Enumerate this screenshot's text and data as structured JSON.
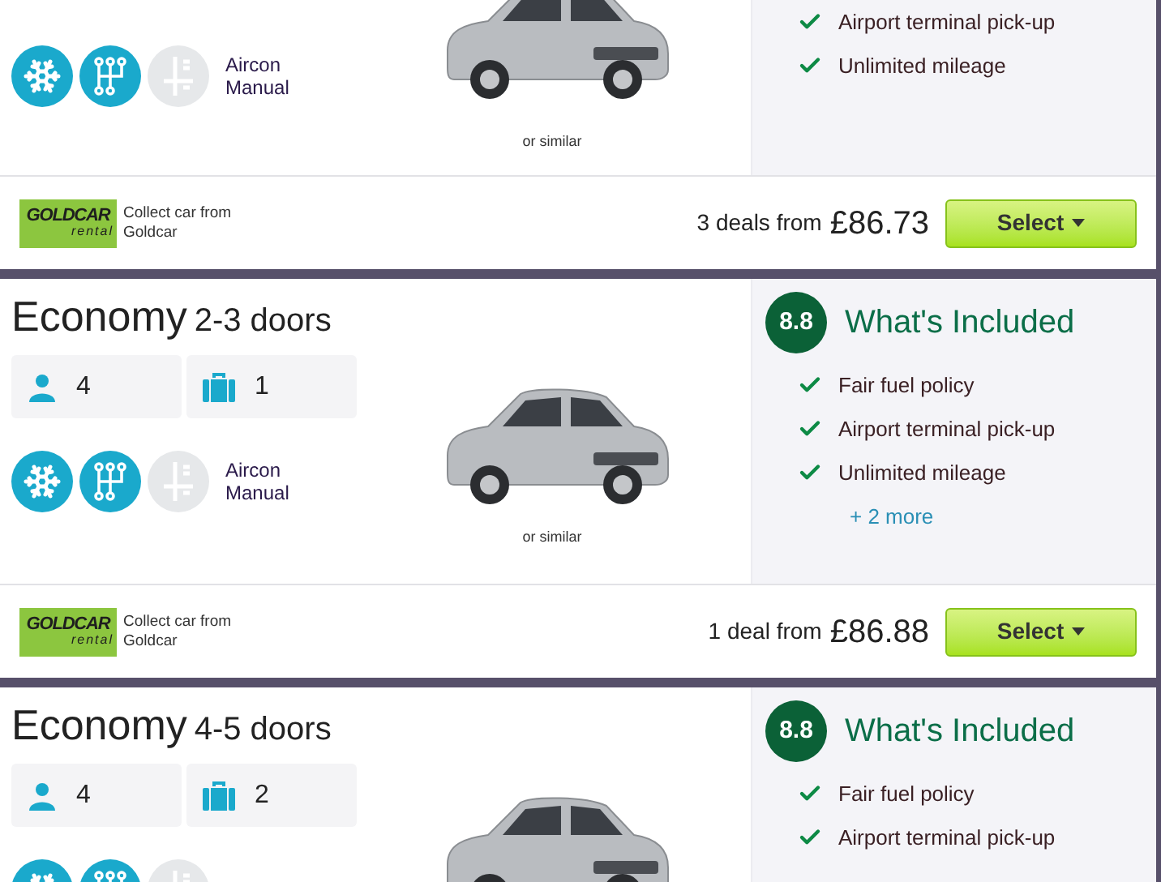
{
  "cards": [
    {
      "features": [
        {
          "kind": "snowflake",
          "on": true
        },
        {
          "kind": "gearshift",
          "on": true
        },
        {
          "kind": "lever",
          "on": false
        }
      ],
      "feature_labels": [
        "Aircon",
        "Manual"
      ],
      "image_caption": "or similar",
      "included": {
        "items": [
          "Airport terminal pick-up",
          "Unlimited mileage"
        ]
      },
      "footer": {
        "logo": {
          "name": "GOLDCAR",
          "sub": "rental"
        },
        "collect": "Collect car from Goldcar",
        "deals": "3 deals from",
        "price": "£86.73",
        "button": "Select"
      }
    },
    {
      "title": "Economy",
      "subtitle": "2-3 doors",
      "specs": [
        {
          "kind": "passengers",
          "value": "4"
        },
        {
          "kind": "bags",
          "value": "1"
        }
      ],
      "features": [
        {
          "kind": "snowflake",
          "on": true
        },
        {
          "kind": "gearshift",
          "on": true
        },
        {
          "kind": "lever",
          "on": false
        }
      ],
      "feature_labels": [
        "Aircon",
        "Manual"
      ],
      "image_caption": "or similar",
      "included": {
        "rating": "8.8",
        "heading": "What's Included",
        "items": [
          "Fair fuel policy",
          "Airport terminal pick-up",
          "Unlimited mileage"
        ],
        "more": "+ 2 more"
      },
      "footer": {
        "logo": {
          "name": "GOLDCAR",
          "sub": "rental"
        },
        "collect": "Collect car from Goldcar",
        "deals": "1 deal from",
        "price": "£86.88",
        "button": "Select"
      }
    },
    {
      "title": "Economy",
      "subtitle": "4-5 doors",
      "specs": [
        {
          "kind": "passengers",
          "value": "4"
        },
        {
          "kind": "bags",
          "value": "2"
        }
      ],
      "features": [
        {
          "kind": "snowflake",
          "on": true
        },
        {
          "kind": "gearshift",
          "on": true
        },
        {
          "kind": "lever",
          "on": false
        }
      ],
      "included": {
        "rating": "8.8",
        "heading": "What's Included",
        "items": [
          "Fair fuel policy",
          "Airport terminal pick-up"
        ]
      }
    }
  ]
}
